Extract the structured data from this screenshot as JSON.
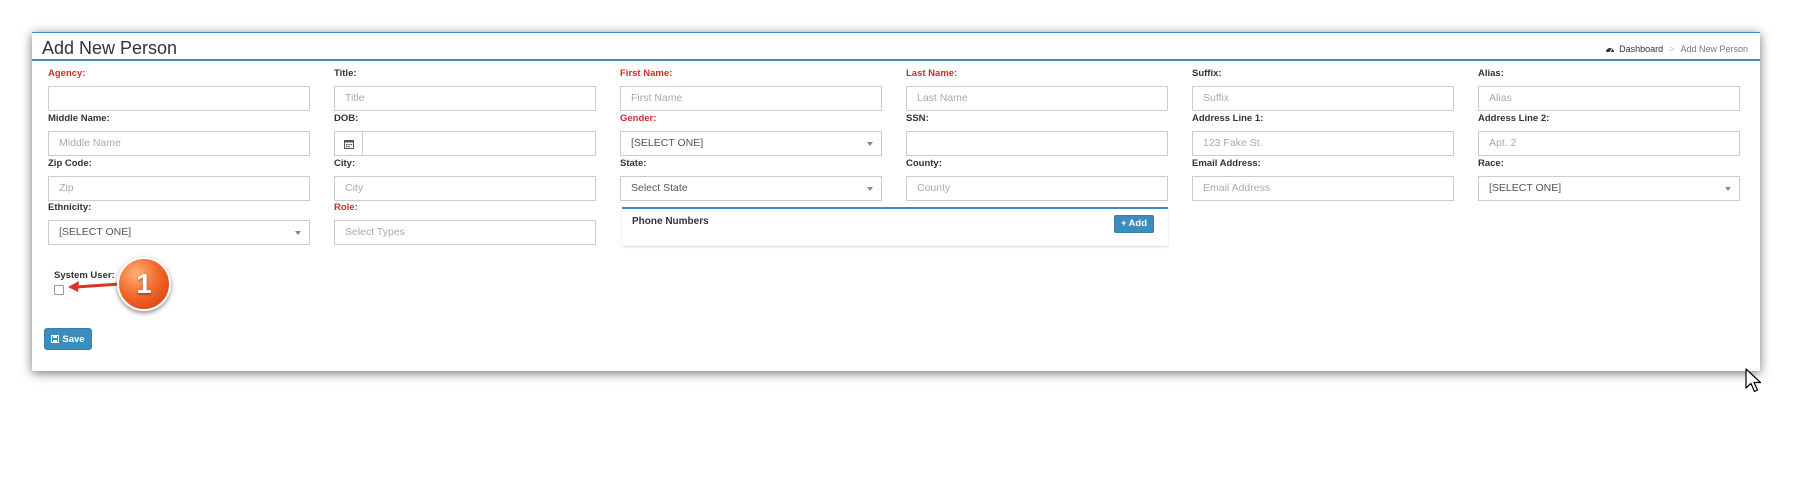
{
  "header": {
    "title": "Add New Person",
    "breadcrumb": {
      "home": "Dashboard",
      "current": "Add New Person"
    }
  },
  "form": {
    "agency": {
      "label": "Agency:",
      "value": "",
      "placeholder": ""
    },
    "title": {
      "label": "Title:",
      "placeholder": "Title"
    },
    "first_name": {
      "label": "First Name:",
      "placeholder": "First Name"
    },
    "last_name": {
      "label": "Last Name:",
      "placeholder": "Last Name"
    },
    "suffix": {
      "label": "Suffix:",
      "placeholder": "Suffix"
    },
    "alias": {
      "label": "Alias:",
      "placeholder": "Alias"
    },
    "middle_name": {
      "label": "Middle Name:",
      "placeholder": "Middle Name"
    },
    "dob": {
      "label": "DOB:",
      "value": ""
    },
    "gender": {
      "label": "Gender:",
      "value": "[SELECT ONE]"
    },
    "ssn": {
      "label": "SSN:",
      "value": ""
    },
    "address1": {
      "label": "Address Line 1:",
      "placeholder": "123 Fake St."
    },
    "address2": {
      "label": "Address Line 2:",
      "placeholder": "Apt. 2"
    },
    "zip": {
      "label": "Zip Code:",
      "placeholder": "Zip"
    },
    "city": {
      "label": "City:",
      "placeholder": "City"
    },
    "state": {
      "label": "State:",
      "value": "Select State"
    },
    "county": {
      "label": "County:",
      "placeholder": "County"
    },
    "email": {
      "label": "Email Address:",
      "placeholder": "Email Address"
    },
    "race": {
      "label": "Race:",
      "value": "[SELECT ONE]"
    },
    "ethnicity": {
      "label": "Ethnicity:",
      "value": "[SELECT ONE]"
    },
    "role": {
      "label": "Role:",
      "placeholder": "Select Types"
    }
  },
  "phone_numbers": {
    "title": "Phone Numbers",
    "add_label": "Add"
  },
  "system_user": {
    "label": "System User:",
    "checked": false
  },
  "save_label": "Save",
  "annotation": {
    "number": "1"
  },
  "colors": {
    "accent": "#3c8dbc",
    "required": "#c9302c",
    "callout": "#f26a2a"
  }
}
